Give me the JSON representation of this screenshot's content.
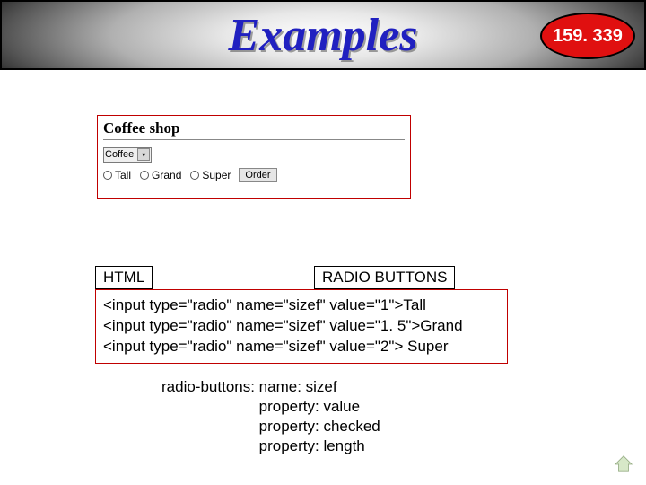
{
  "header": {
    "title": "Examples",
    "badge": "159. 339"
  },
  "form_demo": {
    "title": "Coffee shop",
    "select_value": "Coffee",
    "radios": [
      "Tall",
      "Grand",
      "Super"
    ],
    "button": "Order"
  },
  "labels": {
    "html": "HTML",
    "radio": "RADIO BUTTONS"
  },
  "code_lines": [
    "<input type=\"radio\" name=\"sizef\" value=\"1\">Tall",
    "<input type=\"radio\" name=\"sizef\" value=\"1. 5\">Grand",
    "<input type=\"radio\" name=\"sizef\" value=\"2\"> Super"
  ],
  "props_text": "radio-buttons: name: sizef\n                       property: value\n                       property: checked\n                       property: length"
}
